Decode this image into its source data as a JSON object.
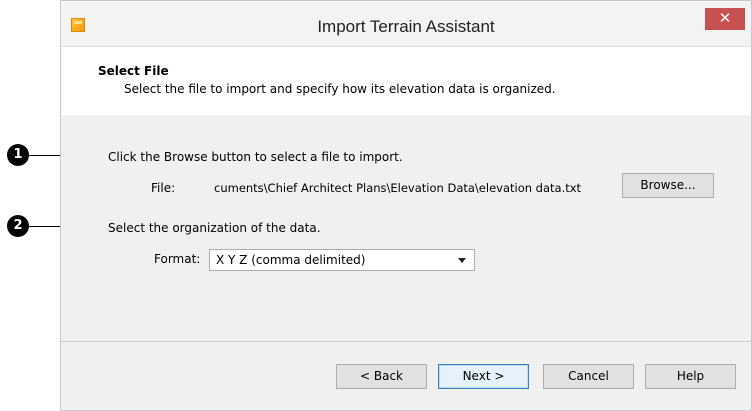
{
  "window": {
    "title": "Import Terrain Assistant",
    "close_glyph": "✕"
  },
  "header": {
    "title": "Select File",
    "subtitle": "Select the file to import and specify how its elevation data is organized."
  },
  "step1": {
    "instruction": "Click the Browse button to select a file to import.",
    "file_label": "File:",
    "file_path": "cuments\\Chief Architect Plans\\Elevation Data\\elevation data.txt",
    "browse_label": "Browse..."
  },
  "step2": {
    "instruction": "Select the organization of the data.",
    "format_label": "Format:",
    "format_value": "X Y Z (comma delimited)"
  },
  "footer": {
    "back_label": "< Back",
    "next_label": "Next >",
    "cancel_label": "Cancel",
    "help_label": "Help"
  },
  "callouts": [
    "1",
    "2"
  ],
  "colors": {
    "close_button": "#c75050",
    "default_button_border": "#3c7fb1",
    "window_background": "#f0f0f0"
  }
}
